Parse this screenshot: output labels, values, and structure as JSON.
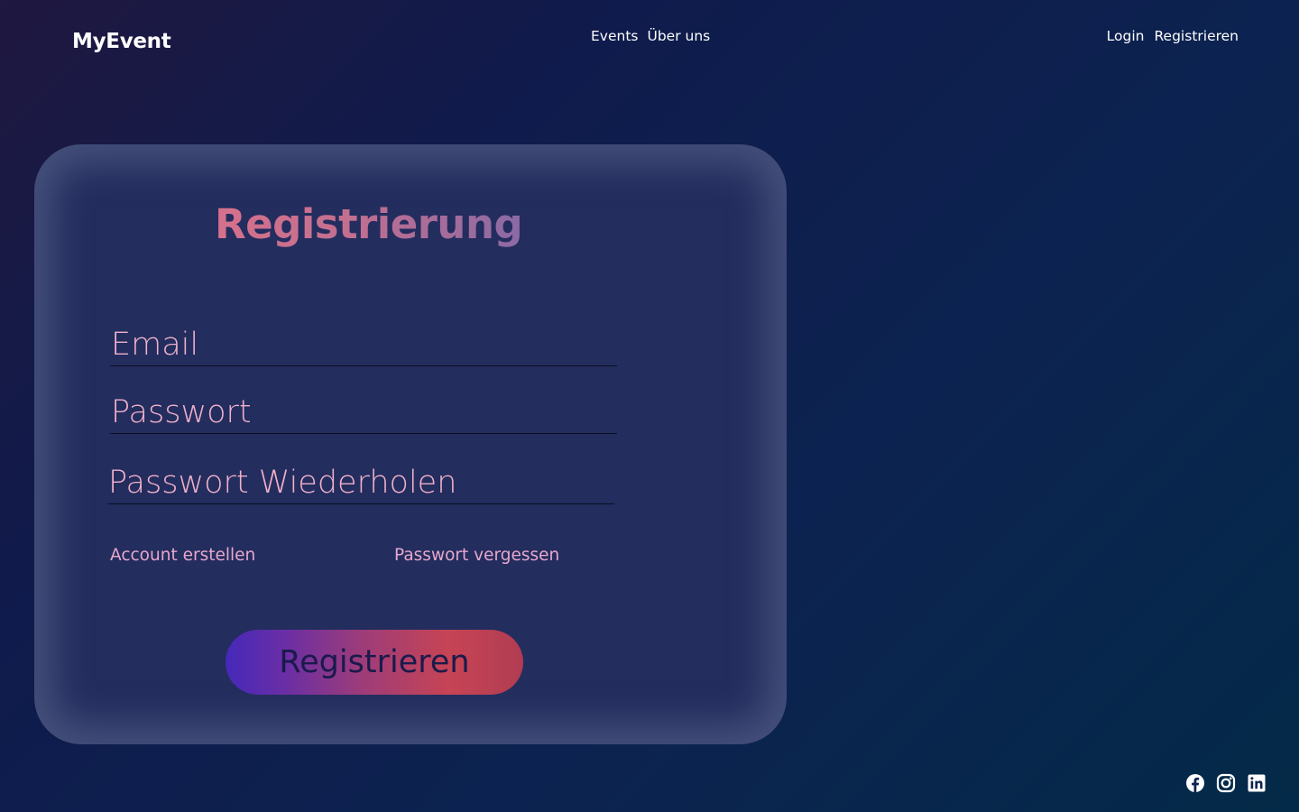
{
  "header": {
    "logo": "MyEvent",
    "nav_center": [
      "Events",
      "Über uns"
    ],
    "nav_right": [
      "Login",
      "Registrieren"
    ]
  },
  "form": {
    "title": "Registrierung",
    "email_placeholder": "Email",
    "password_placeholder": "Passwort",
    "password_repeat_placeholder": "Passwort Wiederholen",
    "create_account_link": "Account erstellen",
    "forgot_password_link": "Passwort vergessen",
    "submit_label": "Registrieren"
  },
  "footer": {
    "social_icons": [
      "facebook-icon",
      "instagram-icon",
      "linkedin-icon"
    ]
  },
  "colors": {
    "accent_pink": "#efb0ca",
    "button_gradient_start": "#4529b9",
    "button_gradient_end": "#c64454"
  }
}
